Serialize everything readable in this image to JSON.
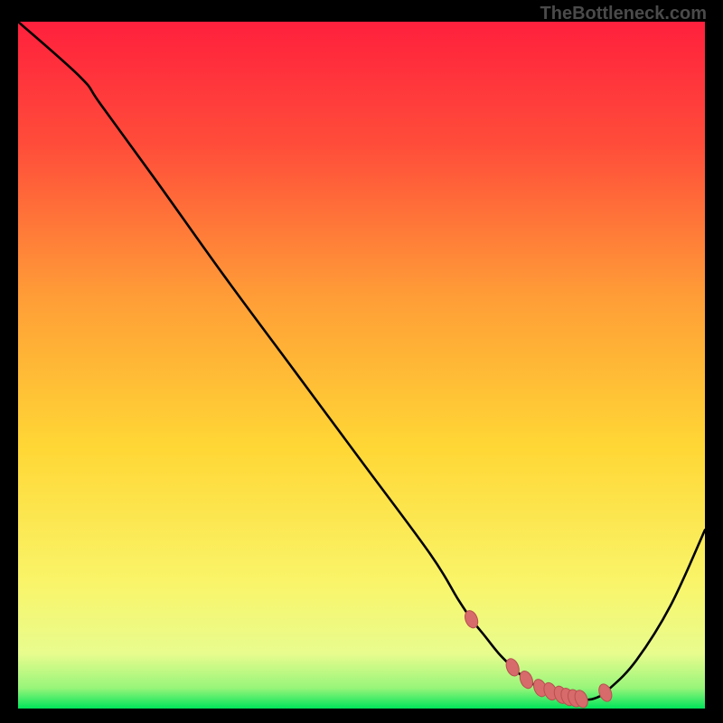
{
  "watermark": "TheBottleneck.com",
  "colors": {
    "gradient_top": "#ff203d",
    "gradient_mid": "#ffd735",
    "gradient_bottom": "#00e45a",
    "curve": "#000000",
    "marker_fill": "#d76a6a",
    "marker_border": "#b85050",
    "frame": "#000000"
  },
  "chart_data": {
    "type": "line",
    "title": "",
    "xlabel": "",
    "ylabel": "",
    "xlim": [
      0,
      100
    ],
    "ylim": [
      0,
      100
    ],
    "series": [
      {
        "name": "curve",
        "x": [
          0,
          9,
          12,
          20,
          30,
          40,
          50,
          60,
          64,
          66,
          68,
          70,
          72,
          74,
          76,
          78,
          80,
          82,
          84,
          86,
          90,
          95,
          100
        ],
        "y": [
          100,
          92,
          88,
          77,
          63,
          49.5,
          36,
          22.5,
          16,
          13,
          10.5,
          8,
          6,
          4.2,
          3,
          2.2,
          1.6,
          1.3,
          1.5,
          2.8,
          7,
          15,
          26
        ]
      },
      {
        "name": "markers",
        "type": "scatter",
        "x": [
          66,
          72,
          74,
          76,
          77.5,
          79,
          80,
          81,
          82,
          85.5
        ],
        "y": [
          13,
          6,
          4.2,
          3,
          2.5,
          2.0,
          1.7,
          1.5,
          1.4,
          2.3
        ]
      }
    ],
    "grid": false,
    "legend": false
  }
}
